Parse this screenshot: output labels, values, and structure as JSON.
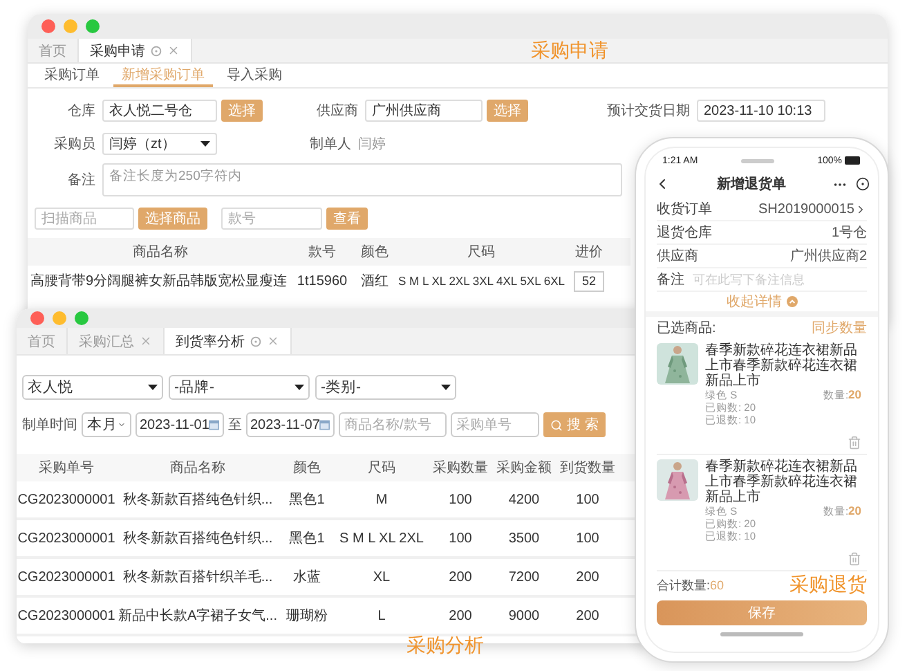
{
  "request_window": {
    "caption": "采购申请",
    "tabs": [
      {
        "label": "首页",
        "selected": false,
        "refresh": false,
        "closable": false
      },
      {
        "label": "采购申请",
        "selected": true,
        "refresh": true,
        "closable": true
      }
    ],
    "subtabs": [
      {
        "label": "采购订单",
        "selected": false
      },
      {
        "label": "新增采购订单",
        "selected": true
      },
      {
        "label": "导入采购",
        "selected": false
      }
    ],
    "warehouse": {
      "label": "仓库",
      "value": "衣人悦二号仓",
      "button": "选择"
    },
    "supplier": {
      "label": "供应商",
      "value": "广州供应商",
      "button": "选择"
    },
    "delivery_date": {
      "label": "预计交货日期",
      "value": "2023-11-10 10:13"
    },
    "buyer": {
      "label": "采购员",
      "value": "闫婷（zt）"
    },
    "creator": {
      "label": "制单人",
      "value": "闫婷"
    },
    "remark": {
      "label": "备注",
      "placeholder": "备注长度为250字符内"
    },
    "scan": {
      "placeholder": "扫描商品",
      "button": "选择商品"
    },
    "style_search": {
      "placeholder": "款号",
      "button": "查看"
    },
    "table": {
      "columns": [
        "商品名称",
        "款号",
        "颜色",
        "尺码",
        "进价"
      ],
      "rows": [
        {
          "name": "高腰背带9分阔腿裤女新品韩版宽松显瘦连",
          "style_no": "1t15960",
          "shade": "酒红",
          "sizes": "S M L XL 2XL 3XL 4XL 5XL 6XL",
          "price": "52"
        }
      ]
    }
  },
  "arrival_window": {
    "caption": "采购分析",
    "tabs": [
      {
        "label": "首页",
        "selected": false,
        "refresh": false,
        "closable": false
      },
      {
        "label": "采购汇总",
        "selected": false,
        "refresh": false,
        "closable": true
      },
      {
        "label": "到货率分析",
        "selected": true,
        "refresh": true,
        "closable": true
      }
    ],
    "filters": [
      "衣人悦",
      "-品牌-",
      "-类别-"
    ],
    "date_label": "制单时间",
    "period": "本月",
    "date_from": "2023-11-01",
    "date_sep": "至",
    "date_to": "2023-11-07",
    "keyword": {
      "placeholder": "商品名称/款号"
    },
    "order_no": {
      "placeholder": "采购单号"
    },
    "search_button": "搜 索",
    "table": {
      "columns": [
        "采购单号",
        "商品名称",
        "颜色",
        "尺码",
        "采购数量",
        "采购金额",
        "到货数量"
      ],
      "rows": [
        {
          "cells": [
            "CG2023000001",
            "秋冬新款百搭纯色针织...",
            "黑色1",
            "M",
            "100",
            "4200",
            "100"
          ]
        },
        {
          "cells": [
            "CG2023000001",
            "秋冬新款百搭纯色针织...",
            "黑色1",
            "S M L XL 2XL",
            "100",
            "3500",
            "100"
          ]
        },
        {
          "cells": [
            "CG2023000001",
            "秋冬新款百搭针织羊毛...",
            "水蓝",
            "XL",
            "200",
            "7200",
            "200"
          ]
        },
        {
          "cells": [
            "CG2023000001",
            "新品中长款A字裙子女气...",
            "珊瑚粉",
            "L",
            "200",
            "9000",
            "200"
          ]
        }
      ]
    }
  },
  "phone": {
    "time": "1:21 AM",
    "battery": "100%",
    "title": "新增退货单",
    "fields": [
      {
        "label": "收货订单",
        "value": "SH2019000015",
        "link": true
      },
      {
        "label": "退货仓库",
        "value": "1号仓",
        "link": false
      },
      {
        "label": "供应商",
        "value": "广州供应商2",
        "link": false
      }
    ],
    "remark": {
      "label": "备注",
      "placeholder": "可在此写下备注信息"
    },
    "collapse": "收起详情",
    "selected_label": "已选商品:",
    "sync": "同步数量",
    "items": [
      {
        "title": "春季新款碎花连衣裙新品上市春季新款碎花连衣裙新品上市",
        "spec": "绿色  S",
        "qty_label": "数量:",
        "qty": "20",
        "bought": "已购数: 20",
        "returned": "已退数: 10"
      },
      {
        "title": "春季新款碎花连衣裙新品上市春季新款碎花连衣裙新品上市",
        "spec": "绿色  S",
        "qty_label": "数量:",
        "qty": "20",
        "bought": "已购数: 20",
        "returned": "已退数: 10"
      }
    ],
    "total_label": "合计数量:",
    "total": "60",
    "save": "保存",
    "caption": "采购退货"
  }
}
